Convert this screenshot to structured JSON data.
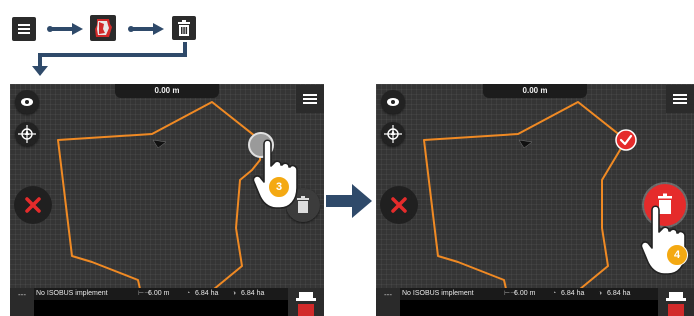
{
  "instruction_bar": {
    "steps": [
      {
        "icon": "hamburger-menu-icon"
      },
      {
        "icon": "boundary-card-icon"
      },
      {
        "icon": "trash-icon"
      }
    ],
    "colors": {
      "arrow": "#2f4a6a",
      "icon_bg": "#2b2b2b",
      "card_red": "#d22a2a"
    }
  },
  "screen_before": {
    "scale_label": "0.00 m",
    "status": {
      "implement": "No ISOBUS implement",
      "width": "6.00 m",
      "area_worked": "6.84 ha",
      "area_total": "6.84 ha"
    },
    "left_tab_label": "---",
    "badge_number": "3"
  },
  "screen_after": {
    "scale_label": "0.00 m",
    "status": {
      "implement": "No ISOBUS implement",
      "width": "6.00 m",
      "area_worked": "6.84 ha",
      "area_total": "6.84 ha"
    },
    "left_tab_label": "---",
    "badge_number": "4"
  },
  "colors": {
    "boundary": "#f08a24",
    "delete_red": "#e52b2b",
    "badge": "#f4a912",
    "screen_bg": "#353535",
    "flow_arrow": "#2f4a6a"
  }
}
